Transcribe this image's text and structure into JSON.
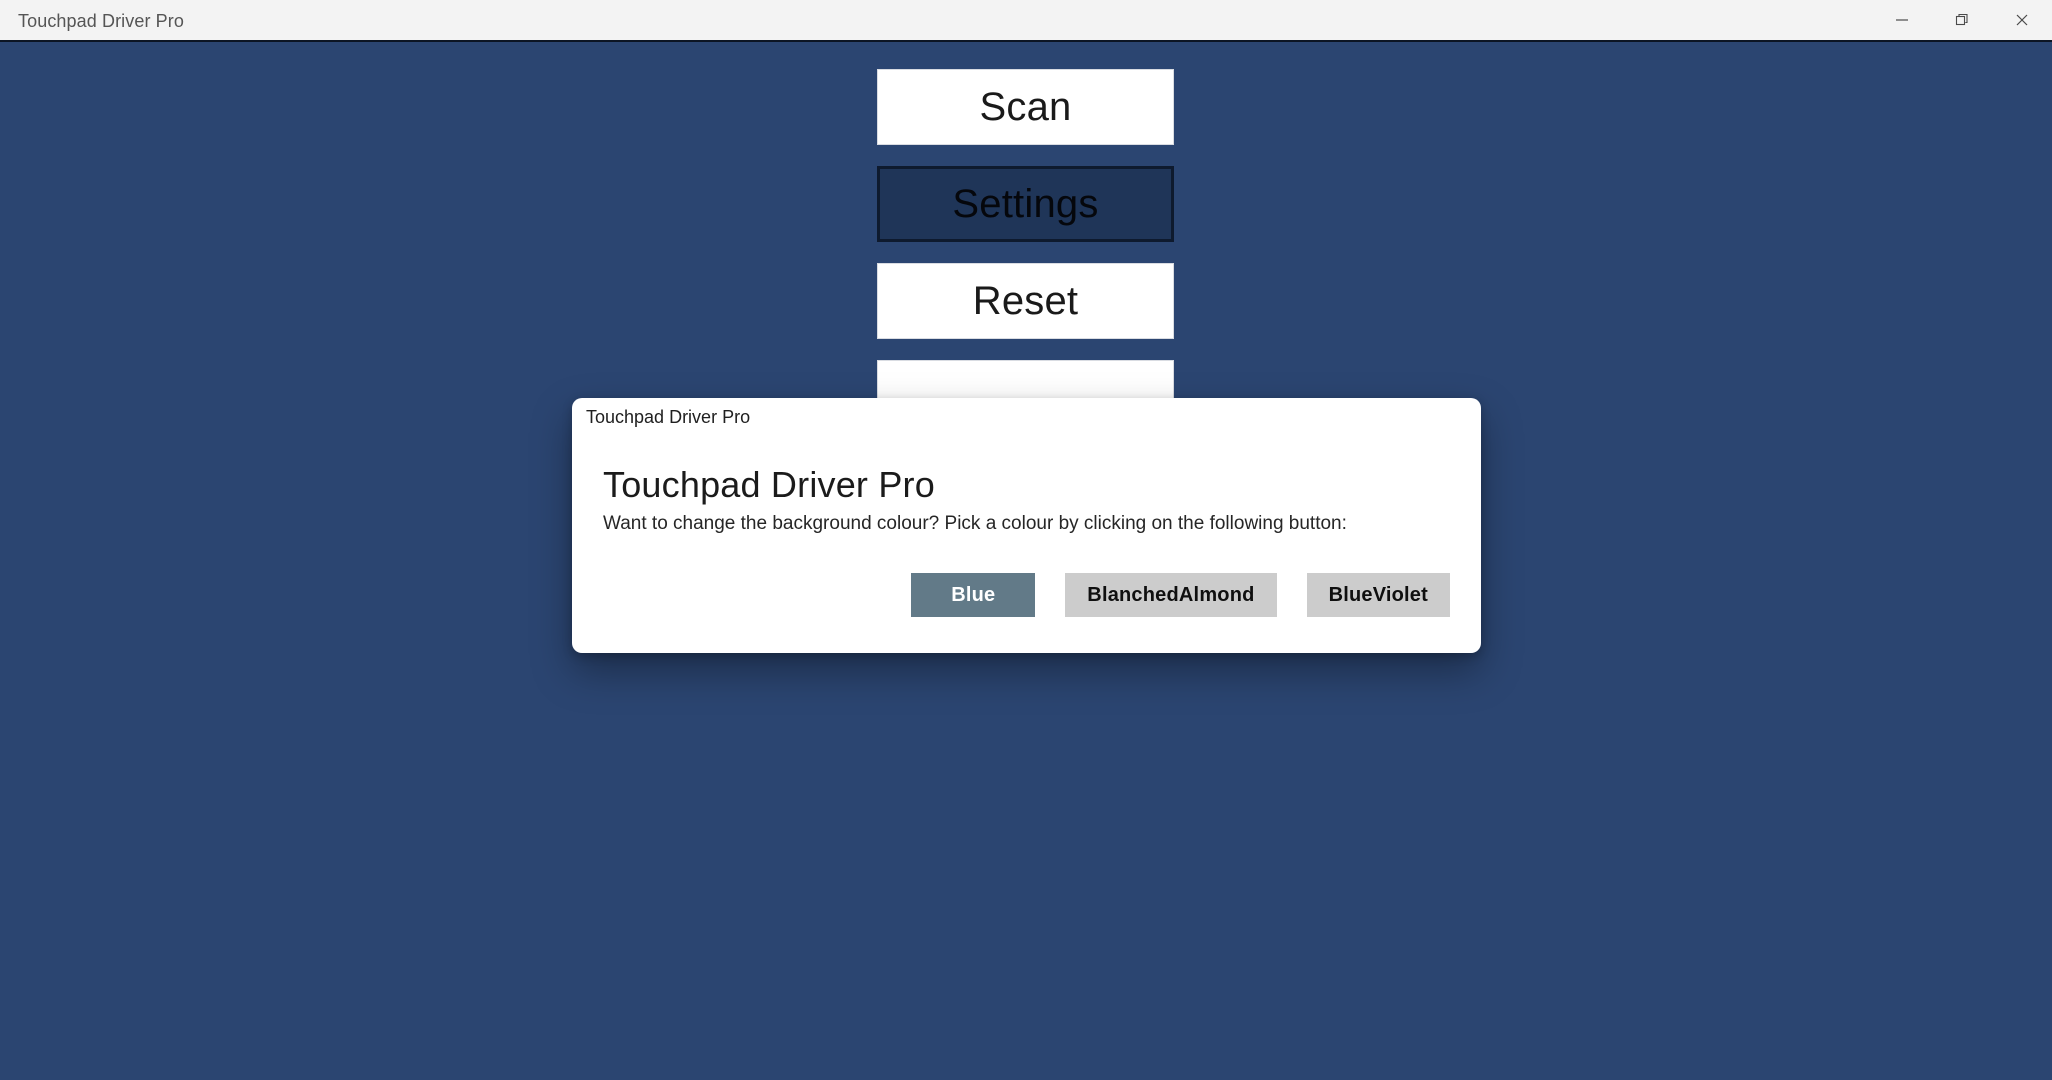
{
  "window": {
    "title": "Touchpad Driver Pro",
    "background_color": "#2b4571",
    "titlebar_background": "#f3f3f3",
    "controls": [
      {
        "name": "minimize",
        "label": "Minimize"
      },
      {
        "name": "restore",
        "label": "Restore"
      },
      {
        "name": "close",
        "label": "Close"
      }
    ]
  },
  "main": {
    "buttons": [
      {
        "label": "Scan",
        "state": "normal"
      },
      {
        "label": "Settings",
        "state": "pressed"
      },
      {
        "label": "Reset",
        "state": "normal"
      },
      {
        "label": "",
        "state": "occluded"
      }
    ]
  },
  "dialog": {
    "titlebar_title": "Touchpad Driver Pro",
    "heading": "Touchpad Driver Pro",
    "message": "Want to change the background colour? Pick a colour by clicking on the following button:",
    "buttons": [
      {
        "label": "Blue",
        "style": "accent",
        "color": "#627a88",
        "text_color": "#ffffff"
      },
      {
        "label": "BlanchedAlmond",
        "style": "default",
        "color": "#cccccc",
        "text_color": "#0f0f0f"
      },
      {
        "label": "BlueViolet",
        "style": "default",
        "color": "#cccccc",
        "text_color": "#0f0f0f"
      }
    ]
  }
}
